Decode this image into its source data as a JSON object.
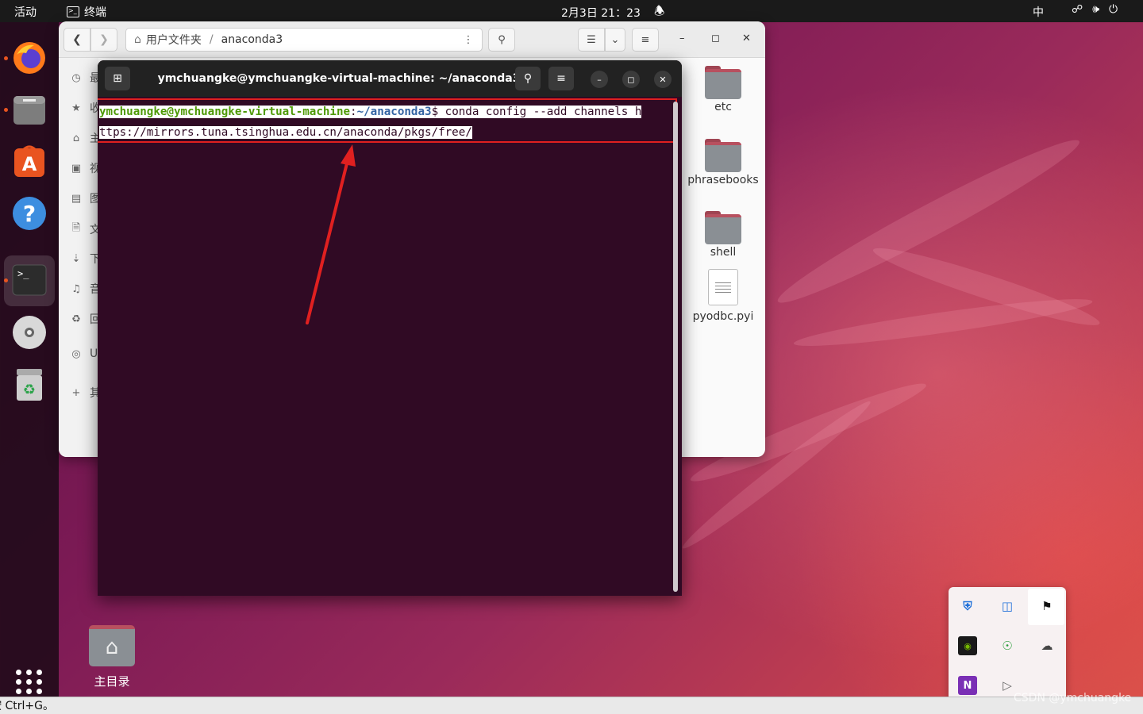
{
  "topbar": {
    "activities": "活动",
    "app_name": "终端",
    "clock": "2月3日 21：23",
    "ime": "中"
  },
  "files_window": {
    "path": [
      "用户文件夹",
      "anaconda3"
    ],
    "sidebar_items": [
      {
        "icon": "clock-icon",
        "label": "最"
      },
      {
        "icon": "star-icon",
        "label": "收"
      },
      {
        "icon": "home-icon",
        "label": "主"
      },
      {
        "icon": "video-icon",
        "label": "视"
      },
      {
        "icon": "image-icon",
        "label": "图"
      },
      {
        "icon": "document-icon",
        "label": "文"
      },
      {
        "icon": "download-icon",
        "label": "下"
      },
      {
        "icon": "music-icon",
        "label": "音"
      },
      {
        "icon": "trash-icon",
        "label": "回"
      },
      {
        "icon": "disc-icon",
        "label": "U"
      },
      {
        "icon": "plus-icon",
        "label": "其"
      }
    ],
    "files": [
      {
        "name": "etc",
        "type": "folder"
      },
      {
        "name": "phrasebooks",
        "type": "folder"
      },
      {
        "name": "shell",
        "type": "folder"
      },
      {
        "name": "pyodbc.pyi",
        "type": "file"
      }
    ]
  },
  "terminal": {
    "title": "ymchuangke@ymchuangke-virtual-machine: ~/anaconda3",
    "prompt_user": "ymchuangke@ymchuangke-virtual-machine",
    "prompt_colon": ":",
    "prompt_path": "~/anaconda3",
    "prompt_symbol": "$ ",
    "command_line1": "conda config --add channels h",
    "command_line2": "ttps://mirrors.tuna.tsinghua.edu.cn/anaconda/pkgs/free/"
  },
  "desktop": {
    "home_label": "主目录"
  },
  "statusbar": {
    "text": "按 Ctrl+G。"
  },
  "watermark": "CSDN @ymchuangke",
  "colors": {
    "terminal_bg": "#300a24",
    "prompt_user": "#8ae234",
    "prompt_path": "#729fcf",
    "annotation_red": "#e02020",
    "ubuntu_orange": "#e95420"
  }
}
